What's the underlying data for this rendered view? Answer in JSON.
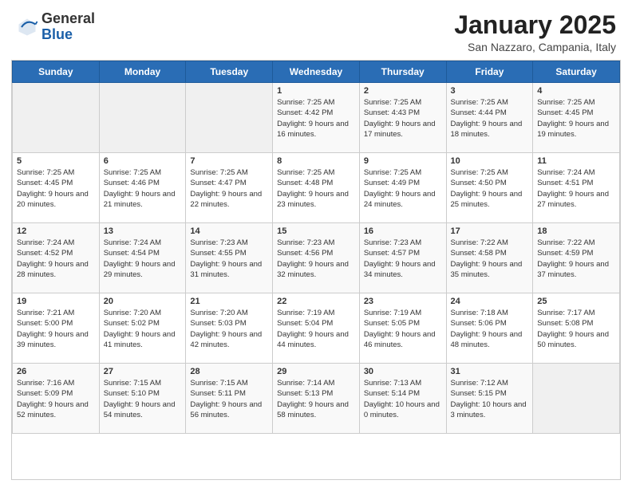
{
  "header": {
    "logo_general": "General",
    "logo_blue": "Blue",
    "month_title": "January 2025",
    "location": "San Nazzaro, Campania, Italy"
  },
  "weekdays": [
    "Sunday",
    "Monday",
    "Tuesday",
    "Wednesday",
    "Thursday",
    "Friday",
    "Saturday"
  ],
  "weeks": [
    [
      {
        "day": "",
        "empty": true
      },
      {
        "day": "",
        "empty": true
      },
      {
        "day": "",
        "empty": true
      },
      {
        "day": "1",
        "sunrise": "7:25 AM",
        "sunset": "4:42 PM",
        "daylight": "9 hours and 16 minutes."
      },
      {
        "day": "2",
        "sunrise": "7:25 AM",
        "sunset": "4:43 PM",
        "daylight": "9 hours and 17 minutes."
      },
      {
        "day": "3",
        "sunrise": "7:25 AM",
        "sunset": "4:44 PM",
        "daylight": "9 hours and 18 minutes."
      },
      {
        "day": "4",
        "sunrise": "7:25 AM",
        "sunset": "4:45 PM",
        "daylight": "9 hours and 19 minutes."
      }
    ],
    [
      {
        "day": "5",
        "sunrise": "7:25 AM",
        "sunset": "4:45 PM",
        "daylight": "9 hours and 20 minutes."
      },
      {
        "day": "6",
        "sunrise": "7:25 AM",
        "sunset": "4:46 PM",
        "daylight": "9 hours and 21 minutes."
      },
      {
        "day": "7",
        "sunrise": "7:25 AM",
        "sunset": "4:47 PM",
        "daylight": "9 hours and 22 minutes."
      },
      {
        "day": "8",
        "sunrise": "7:25 AM",
        "sunset": "4:48 PM",
        "daylight": "9 hours and 23 minutes."
      },
      {
        "day": "9",
        "sunrise": "7:25 AM",
        "sunset": "4:49 PM",
        "daylight": "9 hours and 24 minutes."
      },
      {
        "day": "10",
        "sunrise": "7:25 AM",
        "sunset": "4:50 PM",
        "daylight": "9 hours and 25 minutes."
      },
      {
        "day": "11",
        "sunrise": "7:24 AM",
        "sunset": "4:51 PM",
        "daylight": "9 hours and 27 minutes."
      }
    ],
    [
      {
        "day": "12",
        "sunrise": "7:24 AM",
        "sunset": "4:52 PM",
        "daylight": "9 hours and 28 minutes."
      },
      {
        "day": "13",
        "sunrise": "7:24 AM",
        "sunset": "4:54 PM",
        "daylight": "9 hours and 29 minutes."
      },
      {
        "day": "14",
        "sunrise": "7:23 AM",
        "sunset": "4:55 PM",
        "daylight": "9 hours and 31 minutes."
      },
      {
        "day": "15",
        "sunrise": "7:23 AM",
        "sunset": "4:56 PM",
        "daylight": "9 hours and 32 minutes."
      },
      {
        "day": "16",
        "sunrise": "7:23 AM",
        "sunset": "4:57 PM",
        "daylight": "9 hours and 34 minutes."
      },
      {
        "day": "17",
        "sunrise": "7:22 AM",
        "sunset": "4:58 PM",
        "daylight": "9 hours and 35 minutes."
      },
      {
        "day": "18",
        "sunrise": "7:22 AM",
        "sunset": "4:59 PM",
        "daylight": "9 hours and 37 minutes."
      }
    ],
    [
      {
        "day": "19",
        "sunrise": "7:21 AM",
        "sunset": "5:00 PM",
        "daylight": "9 hours and 39 minutes."
      },
      {
        "day": "20",
        "sunrise": "7:20 AM",
        "sunset": "5:02 PM",
        "daylight": "9 hours and 41 minutes."
      },
      {
        "day": "21",
        "sunrise": "7:20 AM",
        "sunset": "5:03 PM",
        "daylight": "9 hours and 42 minutes."
      },
      {
        "day": "22",
        "sunrise": "7:19 AM",
        "sunset": "5:04 PM",
        "daylight": "9 hours and 44 minutes."
      },
      {
        "day": "23",
        "sunrise": "7:19 AM",
        "sunset": "5:05 PM",
        "daylight": "9 hours and 46 minutes."
      },
      {
        "day": "24",
        "sunrise": "7:18 AM",
        "sunset": "5:06 PM",
        "daylight": "9 hours and 48 minutes."
      },
      {
        "day": "25",
        "sunrise": "7:17 AM",
        "sunset": "5:08 PM",
        "daylight": "9 hours and 50 minutes."
      }
    ],
    [
      {
        "day": "26",
        "sunrise": "7:16 AM",
        "sunset": "5:09 PM",
        "daylight": "9 hours and 52 minutes."
      },
      {
        "day": "27",
        "sunrise": "7:15 AM",
        "sunset": "5:10 PM",
        "daylight": "9 hours and 54 minutes."
      },
      {
        "day": "28",
        "sunrise": "7:15 AM",
        "sunset": "5:11 PM",
        "daylight": "9 hours and 56 minutes."
      },
      {
        "day": "29",
        "sunrise": "7:14 AM",
        "sunset": "5:13 PM",
        "daylight": "9 hours and 58 minutes."
      },
      {
        "day": "30",
        "sunrise": "7:13 AM",
        "sunset": "5:14 PM",
        "daylight": "10 hours and 0 minutes."
      },
      {
        "day": "31",
        "sunrise": "7:12 AM",
        "sunset": "5:15 PM",
        "daylight": "10 hours and 3 minutes."
      },
      {
        "day": "",
        "empty": true
      }
    ]
  ]
}
